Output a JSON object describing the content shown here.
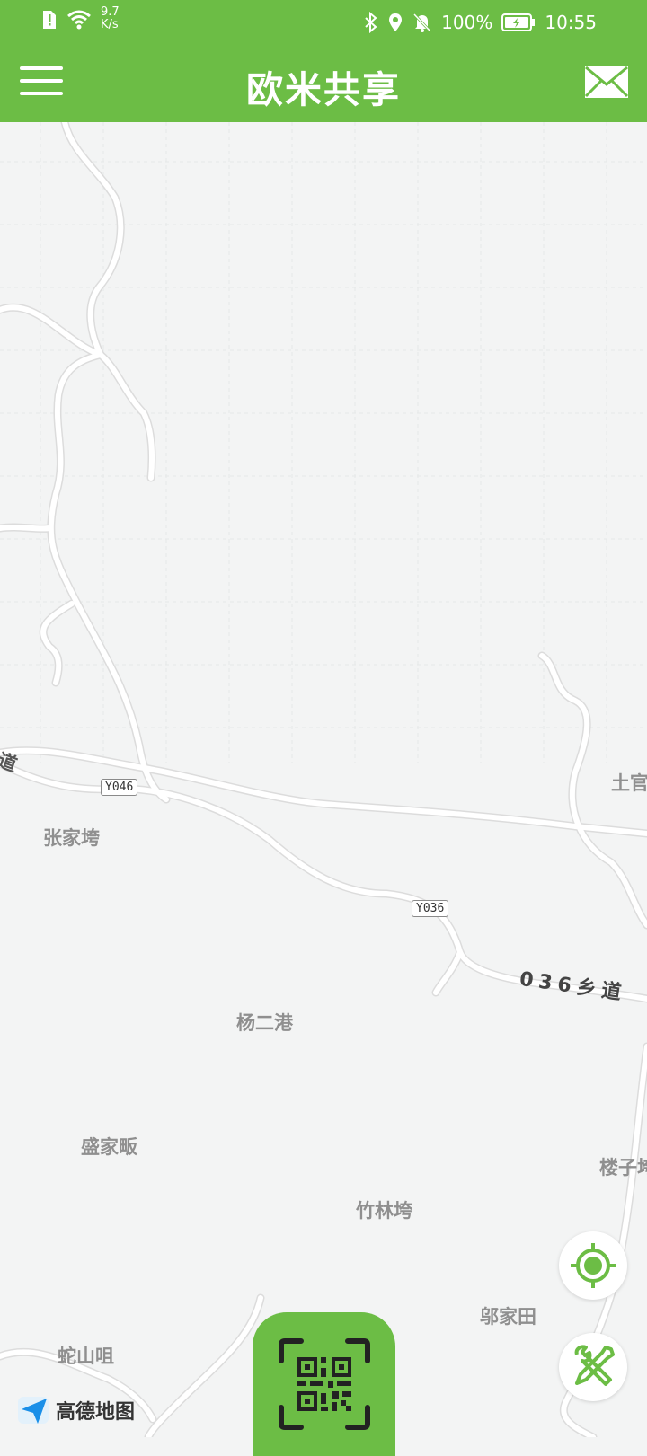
{
  "status": {
    "net_speed_value": "9.7",
    "net_speed_unit": "K/s",
    "battery": "100%",
    "time": "10:55"
  },
  "header": {
    "title": "欧米共享",
    "menu_icon": "hamburger-menu-icon",
    "mail_icon": "envelope-icon"
  },
  "map": {
    "places": {
      "zhangjiawan": "张家垮",
      "yangergang": "杨二港",
      "shengjiafan": "盛家畈",
      "zhulinwan": "竹林垮",
      "woujiatian": "邬家田",
      "shesanju": "蛇山咀",
      "tuguan": "土官",
      "louzi": "楼子垮",
      "dao_left": "道"
    },
    "road_codes": {
      "y046": "Y046",
      "y036": "Y036"
    },
    "road_name": "036乡道",
    "provider": "高德地图"
  },
  "controls": {
    "locate_icon": "crosshair-target-icon",
    "tools_icon": "wrench-screwdriver-icon",
    "scan_icon": "qr-code-scan-icon"
  },
  "colors": {
    "brand_green": "#6cbd45",
    "map_bg": "#f3f4f4",
    "road": "#ffffff"
  }
}
